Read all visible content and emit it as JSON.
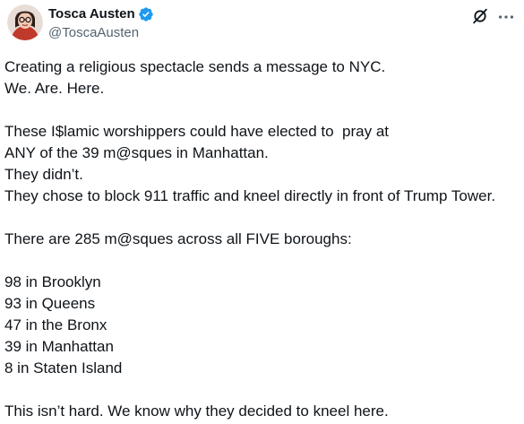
{
  "author": {
    "display_name": "Tosca Austen",
    "handle": "@ToscaAusten",
    "verified_icon": "verified-badge-icon",
    "verified_color": "#1d9bf0"
  },
  "actions": {
    "grok_icon": "grok-icon",
    "more_icon": "more-options-icon"
  },
  "tweet": {
    "lines": [
      "Creating a religious spectacle sends a message to NYC.",
      "We. Are. Here.",
      "",
      "These I$lamic worshippers could have elected to  pray at",
      "ANY of the 39 m@sques in Manhattan.",
      "They didn’t.",
      "They chose to block 911 traffic and kneel directly in front of Trump Tower.",
      "",
      "There are 285 m@sques across all FIVE boroughs:",
      "",
      "98 in Brooklyn",
      "93 in Queens",
      "47 in the Bronx",
      "39 in Manhattan",
      "8 in Staten Island",
      "",
      "This isn’t hard. We know why they decided to kneel here."
    ]
  }
}
